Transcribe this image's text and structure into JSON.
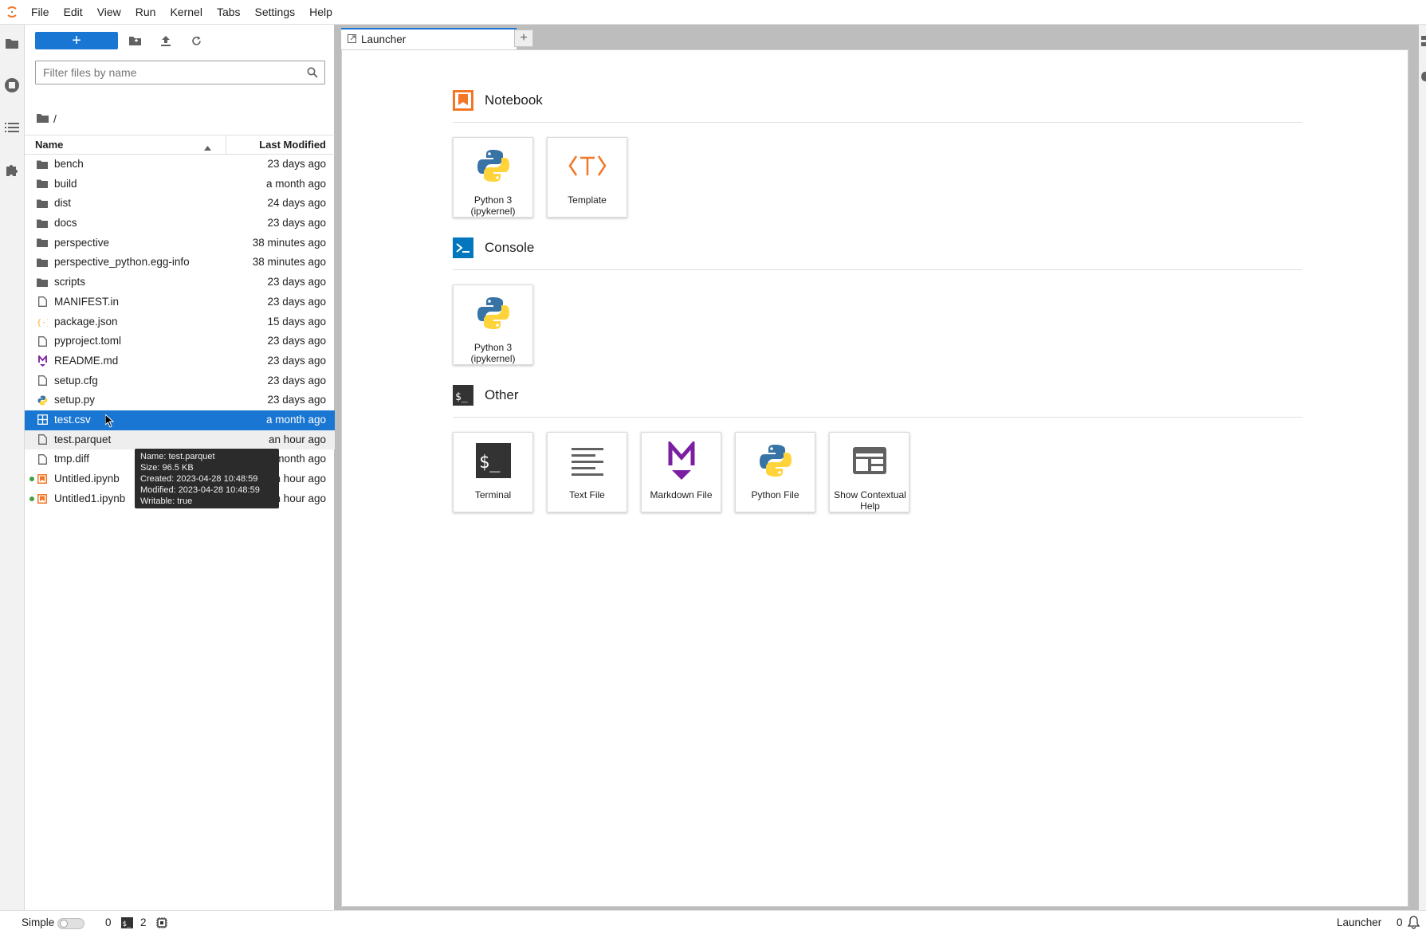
{
  "menubar": {
    "items": [
      "File",
      "Edit",
      "View",
      "Run",
      "Kernel",
      "Tabs",
      "Settings",
      "Help"
    ]
  },
  "file_browser": {
    "new_button_label": "+",
    "filter_placeholder": "Filter files by name",
    "breadcrumb": "/",
    "columns": {
      "name": "Name",
      "modified": "Last Modified"
    },
    "files": [
      {
        "name": "bench",
        "modified": "23 days ago",
        "icon": "folder-icon"
      },
      {
        "name": "build",
        "modified": "a month ago",
        "icon": "folder-icon"
      },
      {
        "name": "dist",
        "modified": "24 days ago",
        "icon": "folder-icon"
      },
      {
        "name": "docs",
        "modified": "23 days ago",
        "icon": "folder-icon"
      },
      {
        "name": "perspective",
        "modified": "38 minutes ago",
        "icon": "folder-icon"
      },
      {
        "name": "perspective_python.egg-info",
        "modified": "38 minutes ago",
        "icon": "folder-icon"
      },
      {
        "name": "scripts",
        "modified": "23 days ago",
        "icon": "folder-icon"
      },
      {
        "name": "MANIFEST.in",
        "modified": "23 days ago",
        "icon": "file-icon"
      },
      {
        "name": "package.json",
        "modified": "15 days ago",
        "icon": "json-icon"
      },
      {
        "name": "pyproject.toml",
        "modified": "23 days ago",
        "icon": "file-icon"
      },
      {
        "name": "README.md",
        "modified": "23 days ago",
        "icon": "markdown-icon"
      },
      {
        "name": "setup.cfg",
        "modified": "23 days ago",
        "icon": "file-icon"
      },
      {
        "name": "setup.py",
        "modified": "23 days ago",
        "icon": "python-icon"
      },
      {
        "name": "test.csv",
        "modified": "a month ago",
        "icon": "spreadsheet-icon",
        "selected": true
      },
      {
        "name": "test.parquet",
        "modified": "an hour ago",
        "icon": "file-icon",
        "hover": true
      },
      {
        "name": "tmp.diff",
        "modified": "a month ago",
        "icon": "file-icon"
      },
      {
        "name": "Untitled.ipynb",
        "modified": "an hour ago",
        "icon": "notebook-icon",
        "running": true
      },
      {
        "name": "Untitled1.ipynb",
        "modified": "an hour ago",
        "icon": "notebook-icon",
        "running": true
      }
    ]
  },
  "tooltip": {
    "lines": [
      "Name: test.parquet",
      "Size: 96.5 KB",
      "Created: 2023-04-28 10:48:59",
      "Modified: 2023-04-28 10:48:59",
      "Writable: true"
    ]
  },
  "tabs": {
    "active": "Launcher",
    "add_label": "+"
  },
  "launcher": {
    "sections": [
      {
        "title": "Notebook",
        "icon": "notebook-section-icon",
        "cards": [
          {
            "label": "Python 3 (ipykernel)",
            "icon": "python-logo-icon"
          },
          {
            "label": "Template",
            "icon": "template-icon"
          }
        ]
      },
      {
        "title": "Console",
        "icon": "console-section-icon",
        "cards": [
          {
            "label": "Python 3 (ipykernel)",
            "icon": "python-logo-icon"
          }
        ]
      },
      {
        "title": "Other",
        "icon": "other-section-icon",
        "cards": [
          {
            "label": "Terminal",
            "icon": "terminal-icon"
          },
          {
            "label": "Text File",
            "icon": "text-file-icon"
          },
          {
            "label": "Markdown File",
            "icon": "markdown-file-icon"
          },
          {
            "label": "Python File",
            "icon": "python-logo-icon"
          },
          {
            "label": "Show Contextual Help",
            "icon": "contextual-help-icon"
          }
        ]
      }
    ]
  },
  "statusbar": {
    "mode_label": "Simple",
    "kernels_count": "0",
    "terminals_count": "2",
    "active_document": "Launcher",
    "notifications_count": "0"
  },
  "colors": {
    "accent": "#1976d2",
    "notebook_orange": "#f37726",
    "console_blue": "#0277bd",
    "markdown_purple": "#7b1fa2",
    "python_blue": "#3873a6",
    "python_yellow": "#ffd43b",
    "running_green": "#43a047"
  }
}
